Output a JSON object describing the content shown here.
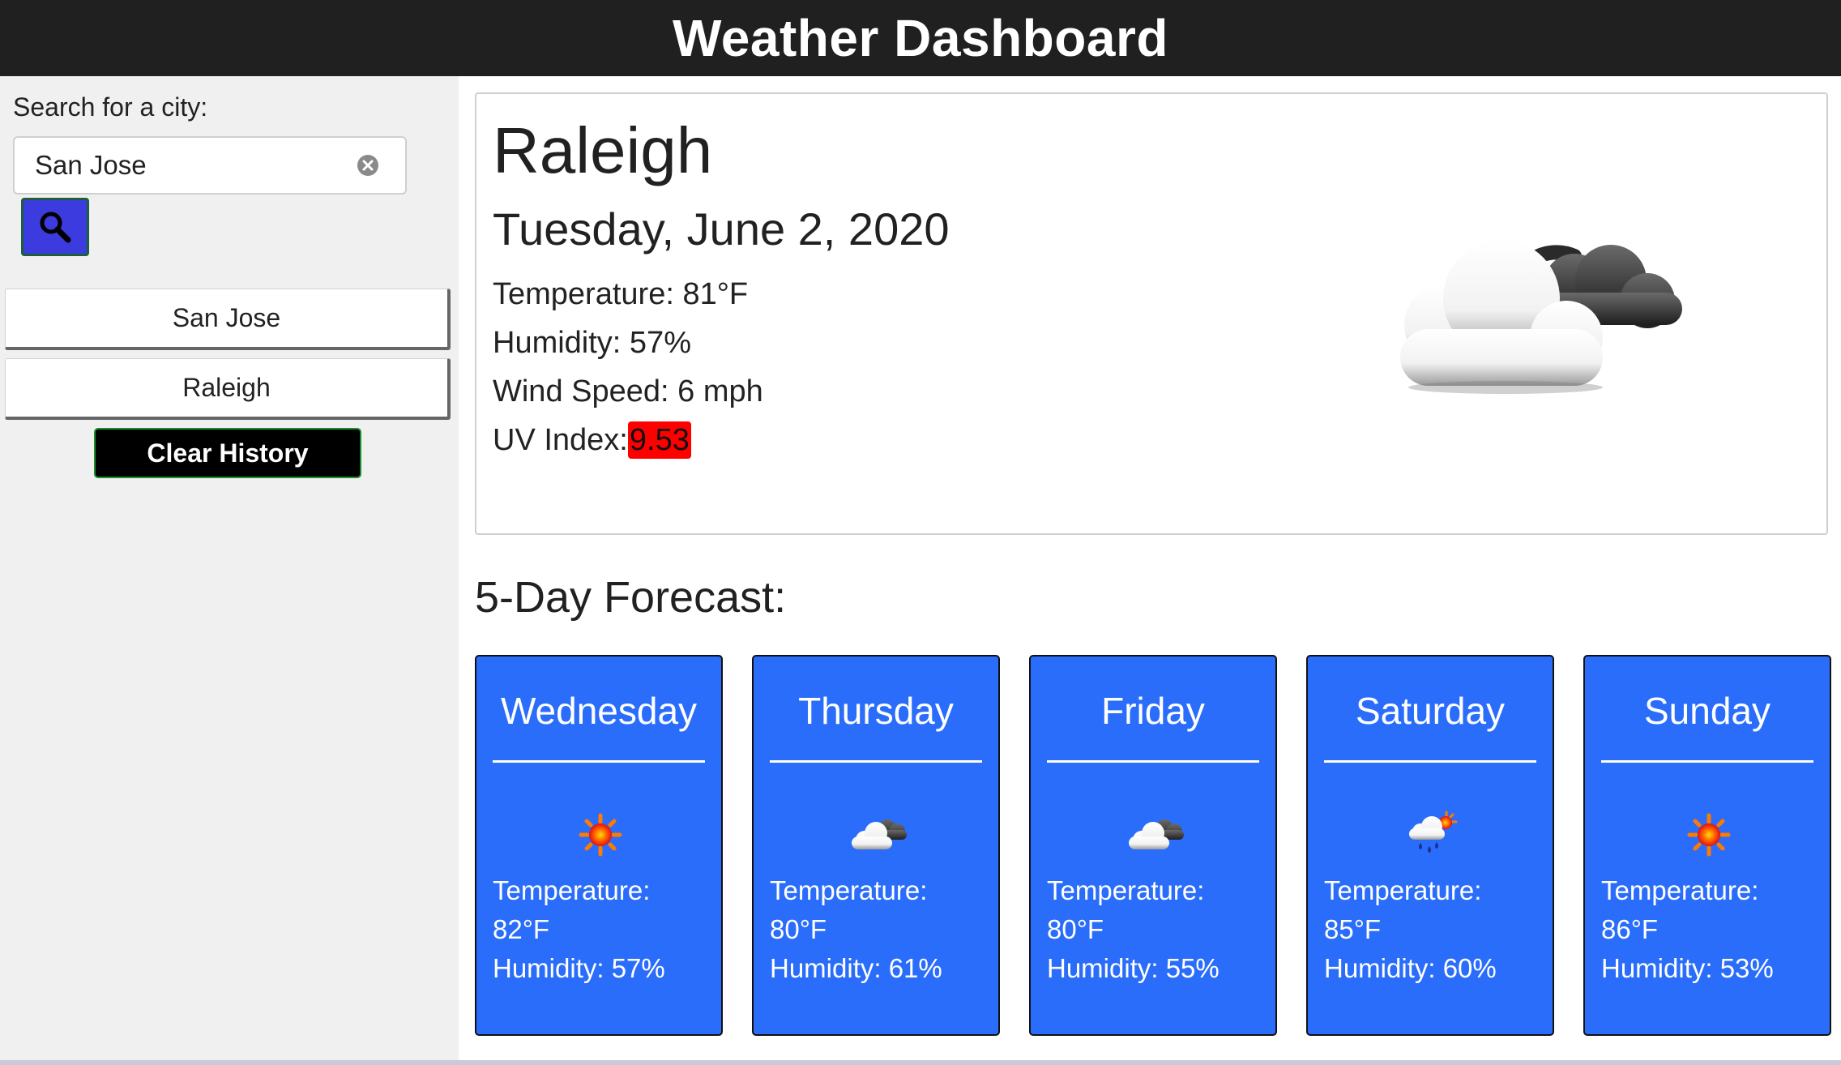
{
  "header": {
    "title": "Weather Dashboard"
  },
  "sidebar": {
    "search_label": "Search for a city:",
    "search_value": "San Jose",
    "history": [
      "San Jose",
      "Raleigh"
    ],
    "clear_label": "Clear History"
  },
  "current": {
    "city": "Raleigh",
    "date": "Tuesday, June 2, 2020",
    "temperature": "Temperature: 81°F",
    "humidity": "Humidity: 57%",
    "wind": "Wind Speed: 6 mph",
    "uv_label": "UV Index:",
    "uv_value": "9.53",
    "uv_color": "#ff0000",
    "icon": "cloudy-moon-icon"
  },
  "forecast": {
    "title": "5-Day Forecast:",
    "temperature_label": "Temperature:",
    "days": [
      {
        "day": "Wednesday",
        "temp": "82°F",
        "humidity": "Humidity: 57%",
        "icon": "sun-icon"
      },
      {
        "day": "Thursday",
        "temp": "80°F",
        "humidity": "Humidity: 61%",
        "icon": "cloudy-icon"
      },
      {
        "day": "Friday",
        "temp": "80°F",
        "humidity": "Humidity: 55%",
        "icon": "cloudy-icon"
      },
      {
        "day": "Saturday",
        "temp": "85°F",
        "humidity": "Humidity: 60%",
        "icon": "rain-sun-icon"
      },
      {
        "day": "Sunday",
        "temp": "86°F",
        "humidity": "Humidity: 53%",
        "icon": "sun-icon"
      }
    ]
  },
  "colors": {
    "card_bg": "#2a6dfa",
    "search_btn": "#3b3bdf",
    "header_bg": "#202020"
  }
}
